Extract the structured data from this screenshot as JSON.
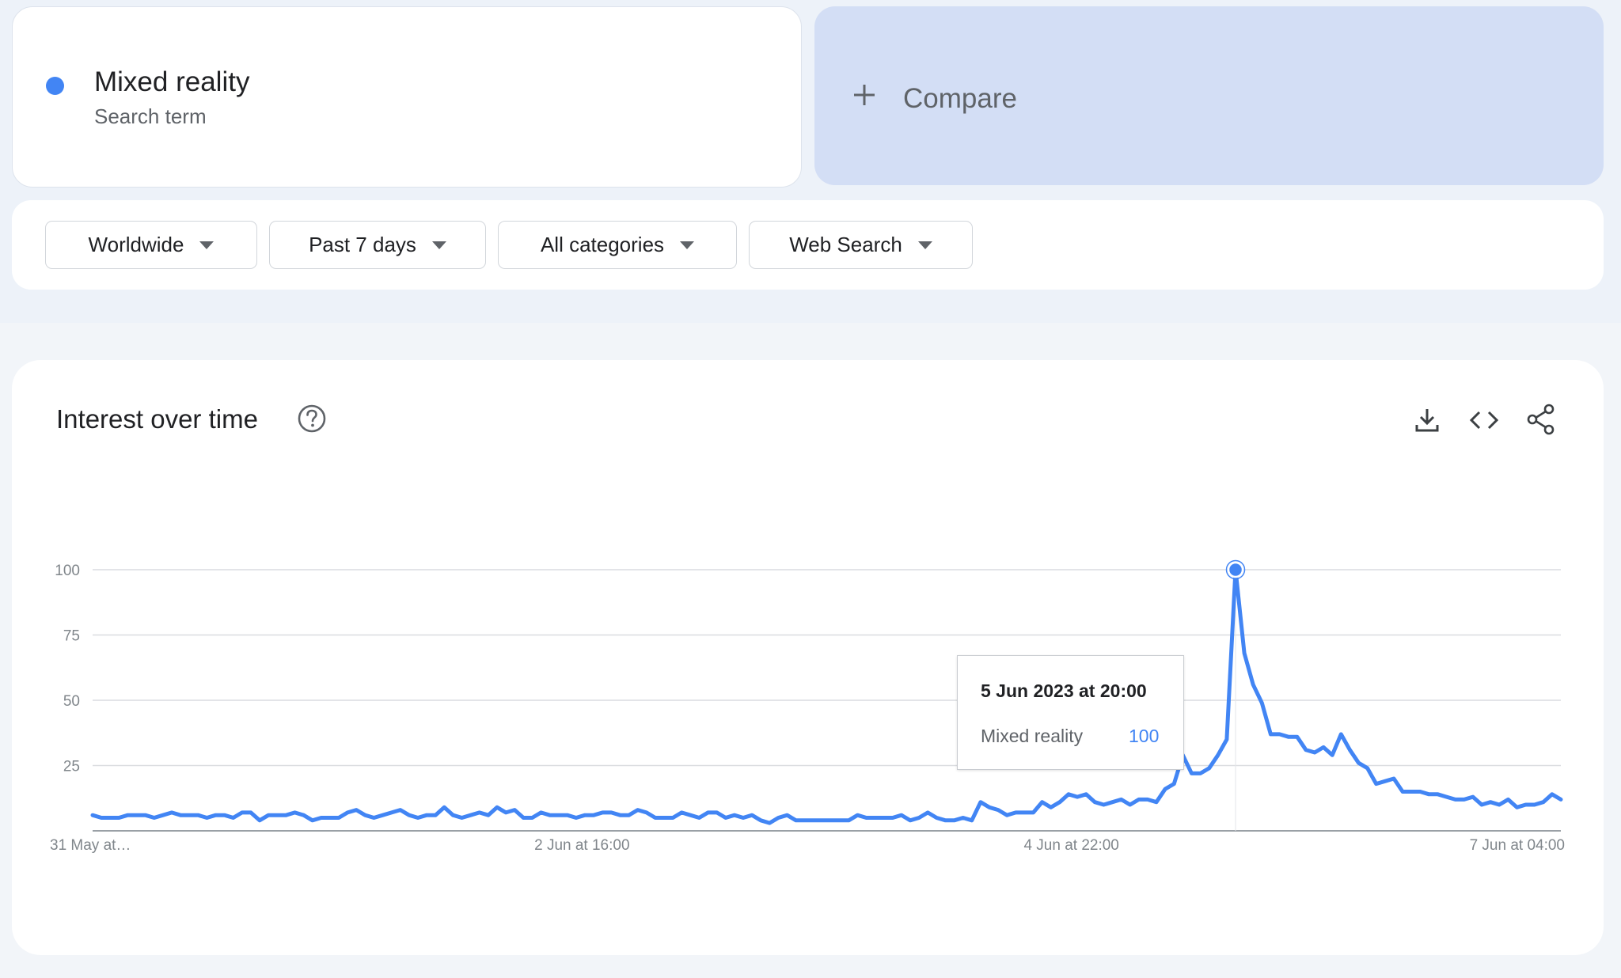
{
  "search_term": {
    "name": "Mixed reality",
    "type": "Search term",
    "color": "#4285f4"
  },
  "compare": {
    "label": "Compare",
    "icon": "plus-icon"
  },
  "filters": [
    {
      "label": "Worldwide",
      "icon": "caret-down-icon"
    },
    {
      "label": "Past 7 days",
      "icon": "caret-down-icon"
    },
    {
      "label": "All categories",
      "icon": "caret-down-icon"
    },
    {
      "label": "Web Search",
      "icon": "caret-down-icon"
    }
  ],
  "chart_card": {
    "title": "Interest over time",
    "help_icon": "help-circle-icon",
    "tools": [
      "download-icon",
      "embed-code-icon",
      "share-icon"
    ]
  },
  "tooltip": {
    "date": "5 Jun 2023 at 20:00",
    "series": "Mixed reality",
    "value": "100"
  },
  "chart_data": {
    "type": "line",
    "title": "",
    "xlabel": "",
    "ylabel": "",
    "ylim": [
      0,
      100
    ],
    "y_ticks": [
      25,
      50,
      75,
      100
    ],
    "x_tick_labels": [
      "31 May at…",
      "2 Jun at 16:00",
      "4 Jun at 22:00",
      "7 Jun at 04:00"
    ],
    "grid": true,
    "line_color": "#4285f4",
    "highlight_index": 130,
    "series": [
      {
        "name": "Mixed reality",
        "values": [
          6,
          5,
          5,
          5,
          6,
          6,
          6,
          5,
          6,
          7,
          6,
          6,
          6,
          5,
          6,
          6,
          5,
          7,
          7,
          4,
          6,
          6,
          6,
          7,
          6,
          4,
          5,
          5,
          5,
          7,
          8,
          6,
          5,
          6,
          7,
          8,
          6,
          5,
          6,
          6,
          9,
          6,
          5,
          6,
          7,
          6,
          9,
          7,
          8,
          5,
          5,
          7,
          6,
          6,
          6,
          5,
          6,
          6,
          7,
          7,
          6,
          6,
          8,
          7,
          5,
          5,
          5,
          7,
          6,
          5,
          7,
          7,
          5,
          6,
          5,
          6,
          4,
          3,
          5,
          6,
          4,
          4,
          4,
          4,
          4,
          4,
          4,
          6,
          5,
          5,
          5,
          5,
          6,
          4,
          5,
          7,
          5,
          4,
          4,
          5,
          4,
          11,
          9,
          8,
          6,
          7,
          7,
          7,
          11,
          9,
          11,
          14,
          13,
          14,
          11,
          10,
          11,
          12,
          10,
          12,
          12,
          11,
          16,
          18,
          29,
          22,
          22,
          24,
          29,
          35,
          100,
          68,
          56,
          49,
          37,
          37,
          36,
          36,
          31,
          30,
          32,
          29,
          37,
          31,
          26,
          24,
          18,
          19,
          20,
          15,
          15,
          15,
          14,
          14,
          13,
          12,
          12,
          13,
          10,
          11,
          10,
          12,
          9,
          10,
          10,
          11,
          14,
          12
        ]
      }
    ]
  }
}
